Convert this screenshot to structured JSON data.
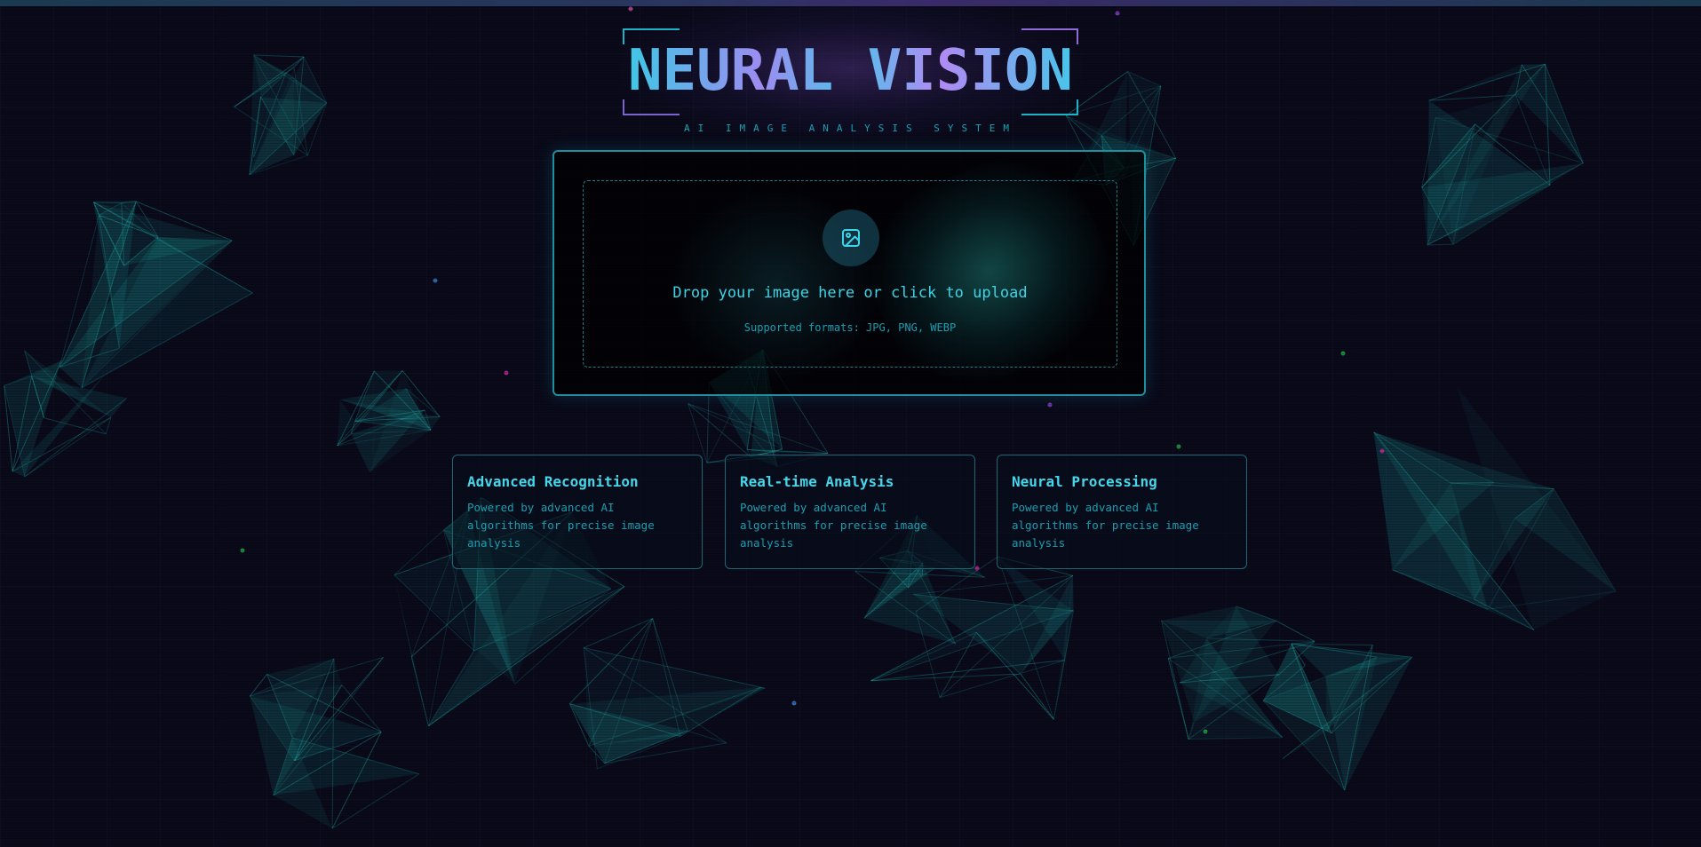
{
  "header": {
    "title": "NEURAL VISION",
    "subtitle": "AI IMAGE ANALYSIS SYSTEM"
  },
  "upload": {
    "icon": "image-icon",
    "prompt": "Drop your image here or click to upload",
    "formats": "Supported formats: JPG, PNG, WEBP"
  },
  "features": [
    {
      "title": "Advanced Recognition",
      "description": "Powered by advanced AI algorithms for precise image analysis"
    },
    {
      "title": "Real-time Analysis",
      "description": "Powered by advanced AI algorithms for precise image analysis"
    },
    {
      "title": "Neural Processing",
      "description": "Powered by advanced AI algorithms for precise image analysis"
    }
  ],
  "colors": {
    "background": "#0a0a1a",
    "accent_cyan": "#3ed3e6",
    "accent_purple": "#9d8cf0",
    "panel_border": "#1f8fa0",
    "mesh": "#1fb5b0"
  }
}
